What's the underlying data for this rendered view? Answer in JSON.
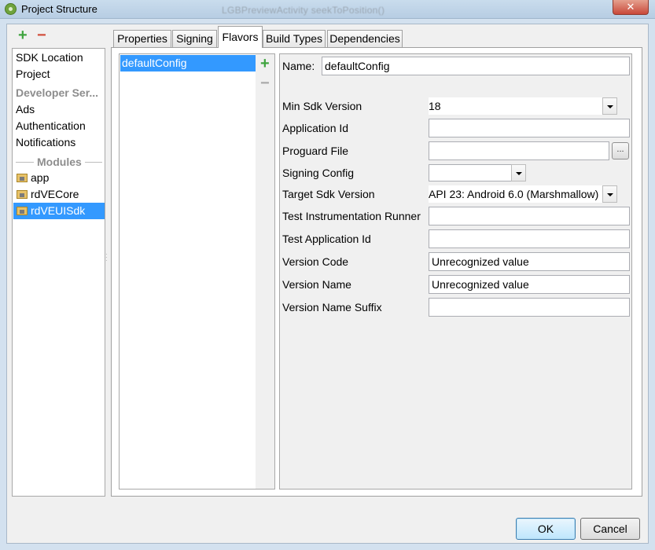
{
  "window": {
    "title": "Project Structure",
    "ghost_text": "LGBPreviewActivity   seekToPosition()",
    "close_label": "✕"
  },
  "left_panel": {
    "toolbar": {
      "add": "+",
      "remove": "−"
    },
    "items": [
      {
        "label": "SDK Location"
      },
      {
        "label": "Project"
      }
    ],
    "developer_group": "Developer Ser...",
    "developer_items": [
      {
        "label": "Ads"
      },
      {
        "label": "Authentication"
      },
      {
        "label": "Notifications"
      }
    ],
    "modules_label": "Modules",
    "modules": [
      {
        "label": "app",
        "selected": false
      },
      {
        "label": "rdVECore",
        "selected": false
      },
      {
        "label": "rdVEUISdk",
        "selected": true
      }
    ]
  },
  "tabs": [
    {
      "label": "Properties",
      "active": false
    },
    {
      "label": "Signing",
      "active": false
    },
    {
      "label": "Flavors",
      "active": true
    },
    {
      "label": "Build Types",
      "active": false
    },
    {
      "label": "Dependencies",
      "active": false
    }
  ],
  "flavors": {
    "items": [
      {
        "label": "defaultConfig",
        "selected": true
      }
    ],
    "add": "+",
    "remove": "−"
  },
  "form": {
    "name_label": "Name:",
    "name_value": "defaultConfig",
    "min_sdk_label": "Min Sdk Version",
    "min_sdk_value": "18",
    "application_id_label": "Application Id",
    "application_id_value": "",
    "proguard_label": "Proguard File",
    "proguard_value": "",
    "browse_label": "...",
    "signing_label": "Signing Config",
    "signing_value": "",
    "target_sdk_label": "Target Sdk Version",
    "target_sdk_value": "API 23: Android 6.0 (Marshmallow)",
    "test_runner_label": "Test Instrumentation Runner",
    "test_runner_value": "",
    "test_app_id_label": "Test Application Id",
    "test_app_id_value": "",
    "version_code_label": "Version Code",
    "version_code_value": "Unrecognized value",
    "version_name_label": "Version Name",
    "version_name_value": "Unrecognized value",
    "version_suffix_label": "Version Name Suffix",
    "version_suffix_value": ""
  },
  "buttons": {
    "ok": "OK",
    "cancel": "Cancel"
  },
  "colors": {
    "selection": "#3399ff",
    "add_green": "#3fa43f",
    "remove_red": "#d14c3a"
  }
}
